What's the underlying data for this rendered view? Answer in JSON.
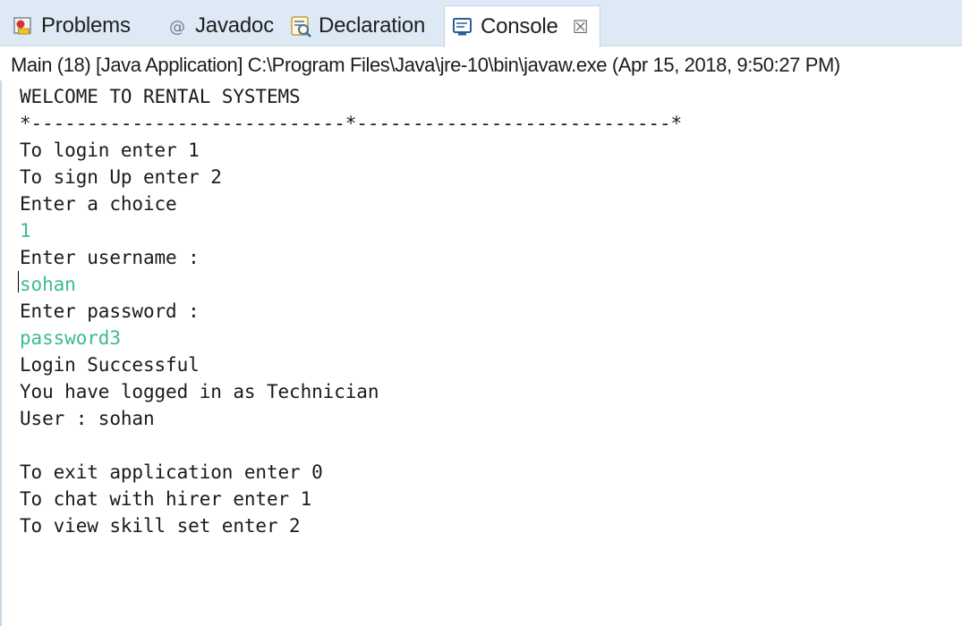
{
  "tabs": [
    {
      "label": "Problems",
      "icon": "problems-icon",
      "active": false
    },
    {
      "label": "Javadoc",
      "icon": "javadoc-at-icon",
      "active": false
    },
    {
      "label": "Declaration",
      "icon": "declaration-icon",
      "active": false
    },
    {
      "label": "Console",
      "icon": "console-icon",
      "active": true
    }
  ],
  "close_glyph": "☒",
  "launch_info": "Main (18) [Java Application] C:\\Program Files\\Java\\jre-10\\bin\\javaw.exe (Apr 15, 2018, 9:50:27 PM)",
  "console_lines": [
    {
      "text": "WELCOME TO RENTAL SYSTEMS",
      "kind": "output"
    },
    {
      "text": "*----------------------------*----------------------------*",
      "kind": "output"
    },
    {
      "text": "To login enter 1",
      "kind": "output"
    },
    {
      "text": "To sign Up enter 2",
      "kind": "output"
    },
    {
      "text": "Enter a choice",
      "kind": "output"
    },
    {
      "text": "1",
      "kind": "input"
    },
    {
      "text": "Enter username :",
      "kind": "output"
    },
    {
      "text": "sohan",
      "kind": "input"
    },
    {
      "text": "Enter password :",
      "kind": "output"
    },
    {
      "text": "password3",
      "kind": "input"
    },
    {
      "text": "Login Successful",
      "kind": "output"
    },
    {
      "text": "You have logged in as Technician",
      "kind": "output"
    },
    {
      "text": "User : sohan",
      "kind": "output"
    },
    {
      "text": "",
      "kind": "output"
    },
    {
      "text": "To exit application enter 0",
      "kind": "output"
    },
    {
      "text": "To chat with hirer enter 1",
      "kind": "output"
    },
    {
      "text": "To view skill set enter 2",
      "kind": "output"
    }
  ],
  "colors": {
    "input_text": "#3dbb96",
    "output_text": "#1a1a1a",
    "tabbar_bg": "#ddeaf6"
  }
}
